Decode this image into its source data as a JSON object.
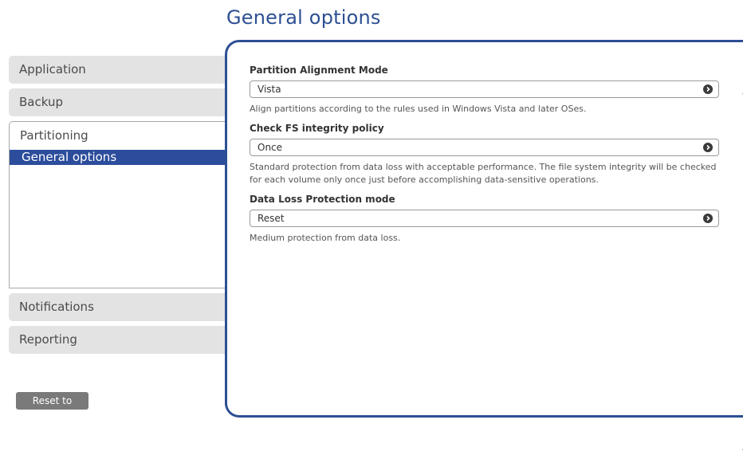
{
  "page": {
    "title": "General options"
  },
  "sidebar": {
    "items": [
      {
        "label": "Application"
      },
      {
        "label": "Backup"
      },
      {
        "label": "Partitioning",
        "sub_items": [
          {
            "label": "General options",
            "active": true
          }
        ]
      },
      {
        "label": "Notifications"
      },
      {
        "label": "Reporting"
      }
    ],
    "reset_label": "Reset to default"
  },
  "fields": [
    {
      "label": "Partition Alignment Mode",
      "value": "Vista",
      "description": "Align partitions according to the rules used in Windows Vista and later OSes."
    },
    {
      "label": "Check FS integrity policy",
      "value": "Once",
      "description": "Standard protection from data loss with acceptable performance. The file system integrity will be checked for each volume only once just before accomplishing data-sensitive operations."
    },
    {
      "label": "Data Loss Protection mode",
      "value": "Reset",
      "description": "Medium protection from data loss."
    }
  ],
  "colors": {
    "accent": "#2d4f93",
    "active_item": "#2c4d9b",
    "sidebar_bg": "#e3e3e3"
  },
  "icons": {
    "select_chevron": "chevron-right-circle-icon",
    "scroll_up": "chevron-up-icon",
    "scroll_down": "chevron-down-icon"
  }
}
